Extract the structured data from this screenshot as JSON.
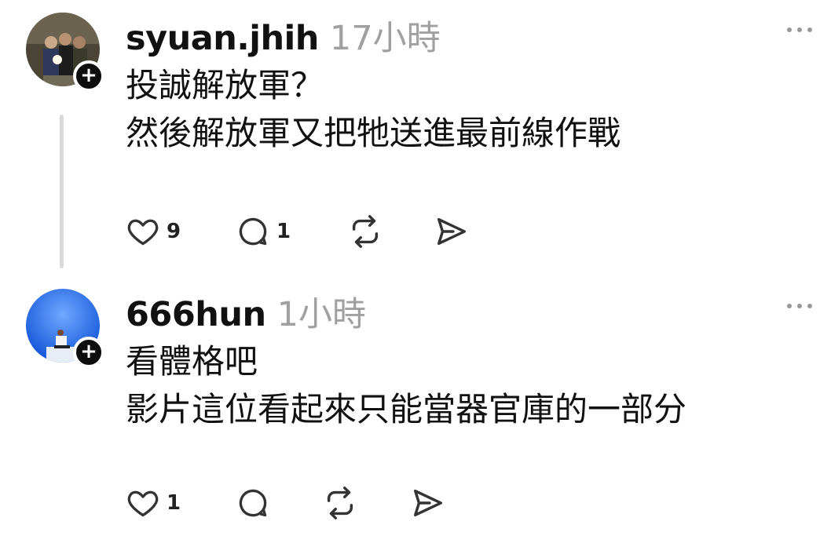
{
  "posts": [
    {
      "username": "syuan.jhih",
      "time": "17小時",
      "lines": [
        "投誠解放軍？",
        "然後解放軍又把牠送進最前線作戰"
      ],
      "likes": "9",
      "replies": "1"
    },
    {
      "username": "666hun",
      "time": "1小時",
      "lines": [
        "看體格吧",
        "影片這位看起來只能當器官庫的一部分"
      ],
      "likes": "1",
      "replies": ""
    }
  ],
  "icons": {
    "like": "heart-icon",
    "reply": "comment-icon",
    "repost": "repost-icon",
    "share": "send-icon",
    "more": "more-icon",
    "follow": "plus-icon"
  }
}
